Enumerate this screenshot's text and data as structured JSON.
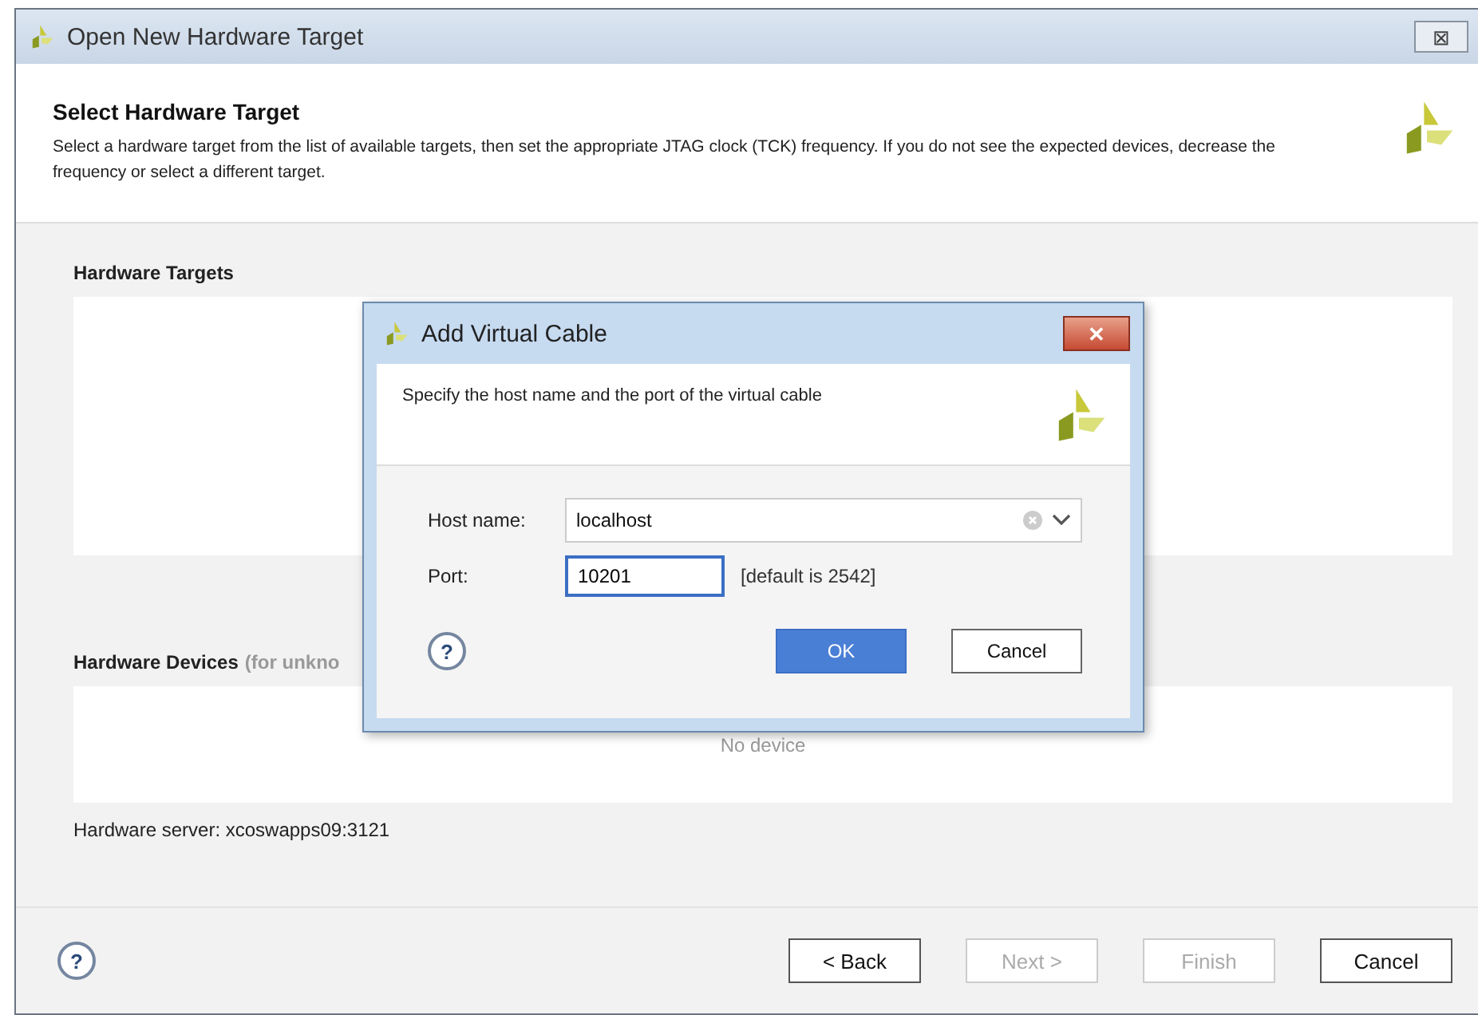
{
  "window": {
    "title": "Open New Hardware Target",
    "close": "⊠"
  },
  "header": {
    "title": "Select Hardware Target",
    "description": "Select a hardware target from the list of available targets, then set the appropriate JTAG clock (TCK) frequency. If you do not see the expected devices, decrease the frequency or select a different target."
  },
  "targets": {
    "label": "Hardware Targets"
  },
  "devices": {
    "label": "Hardware Devices",
    "note": "(for unkno",
    "empty": "No device"
  },
  "server": "Hardware server: xcoswapps09:3121",
  "footer": {
    "help": "?",
    "buttons": [
      {
        "label": "< Back",
        "disabled": false
      },
      {
        "label": "Next >",
        "disabled": true
      },
      {
        "label": "Finish",
        "disabled": true
      },
      {
        "label": "Cancel",
        "disabled": false
      }
    ]
  },
  "dialog": {
    "title": "Add Virtual Cable",
    "close": "✕",
    "description": "Specify the host name and the port of the virtual cable",
    "host": {
      "label": "Host name:",
      "value": "localhost"
    },
    "port": {
      "label": "Port:",
      "value": "10201",
      "hint": "[default is 2542]"
    },
    "help": "?",
    "buttons": [
      {
        "label": "OK",
        "primary": true
      },
      {
        "label": "Cancel",
        "primary": false
      }
    ]
  }
}
